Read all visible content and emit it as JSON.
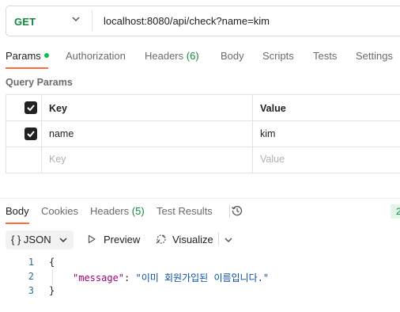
{
  "request": {
    "method": "GET",
    "url": "localhost:8080/api/check?name=kim"
  },
  "request_tabs": [
    {
      "label": "Params",
      "active": true
    },
    {
      "label": "Authorization"
    },
    {
      "label": "Headers",
      "count": "(6)"
    },
    {
      "label": "Body"
    },
    {
      "label": "Scripts"
    },
    {
      "label": "Tests"
    },
    {
      "label": "Settings"
    }
  ],
  "query_params": {
    "title": "Query Params",
    "columns": [
      "Key",
      "Value"
    ],
    "rows": [
      {
        "checked": true,
        "key": "name",
        "value": "kim"
      }
    ],
    "placeholder": {
      "key": "Key",
      "value": "Value"
    }
  },
  "response_tabs": [
    {
      "label": "Body",
      "active": true
    },
    {
      "label": "Cookies"
    },
    {
      "label": "Headers",
      "count": "(5)"
    },
    {
      "label": "Test Results"
    }
  ],
  "status_chip": "2",
  "response_toolbar": {
    "format": "JSON",
    "format_icon": "{ }",
    "preview": "Preview",
    "visualize": "Visualize"
  },
  "response_body": {
    "line_numbers": [
      "1",
      "2",
      "3"
    ],
    "open_brace": "{",
    "key": "\"message\"",
    "colon": ": ",
    "value": "\"이미 회원가입된 이름입니다.\"",
    "close_brace": "}"
  },
  "colors": {
    "method": "#0f8a3c",
    "accent": "#ff6c37",
    "active_dot": "#0cbb52"
  },
  "icons": [
    "chevron-down-icon",
    "checkbox-checked-icon",
    "history-icon",
    "play-icon",
    "visualize-icon"
  ]
}
